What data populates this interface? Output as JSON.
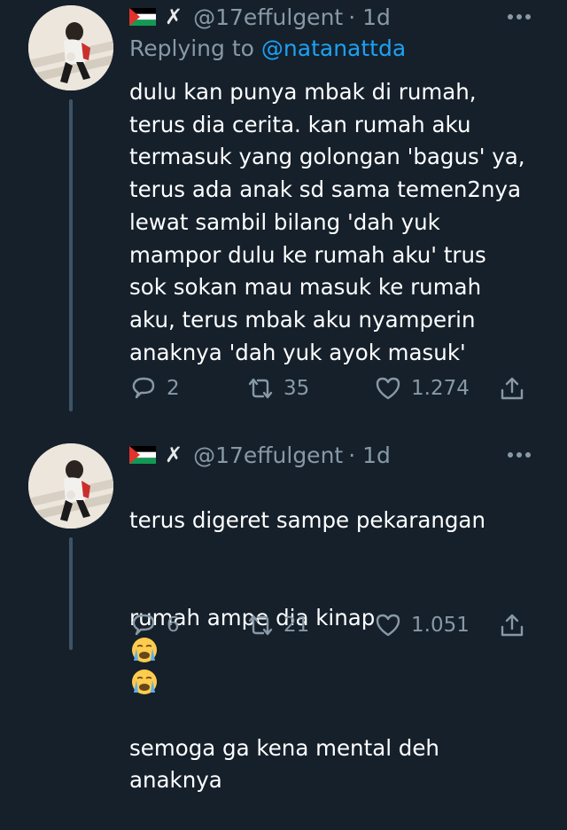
{
  "tweets": [
    {
      "handle": "@17effulgent",
      "dot_time": "· 1d",
      "replying_prefix": "Replying to",
      "replying_to": "@natanattda",
      "text": "dulu kan punya mbak di rumah,\nterus dia cerita. kan rumah aku\ntermasuk yang golongan 'bagus' ya,\nterus ada anak sd sama temen2nya\nlewat sambil bilang 'dah yuk\nmampor dulu ke rumah aku' trus\nsok sokan mau masuk ke rumah\naku, terus mbak aku nyamperin\nanaknya 'dah yuk ayok masuk'",
      "replies": "2",
      "retweets": "35",
      "likes": "1.274"
    },
    {
      "handle": "@17effulgent",
      "dot_time": "· 1d",
      "text_line1": "terus digeret sampe pekarangan",
      "text_line2_prefix": "rumah ampe dia kinap",
      "text_rest": "semoga ga kena mental deh\nanaknya",
      "emojis": [
        "loudly-crying-face",
        "loudly-crying-face"
      ],
      "replies": "6",
      "retweets": "21",
      "likes": "1.051"
    }
  ],
  "colors": {
    "background": "#15202b",
    "secondary_text": "#8899a6",
    "mention": "#1da1f2",
    "thread_line": "#3d5466"
  }
}
